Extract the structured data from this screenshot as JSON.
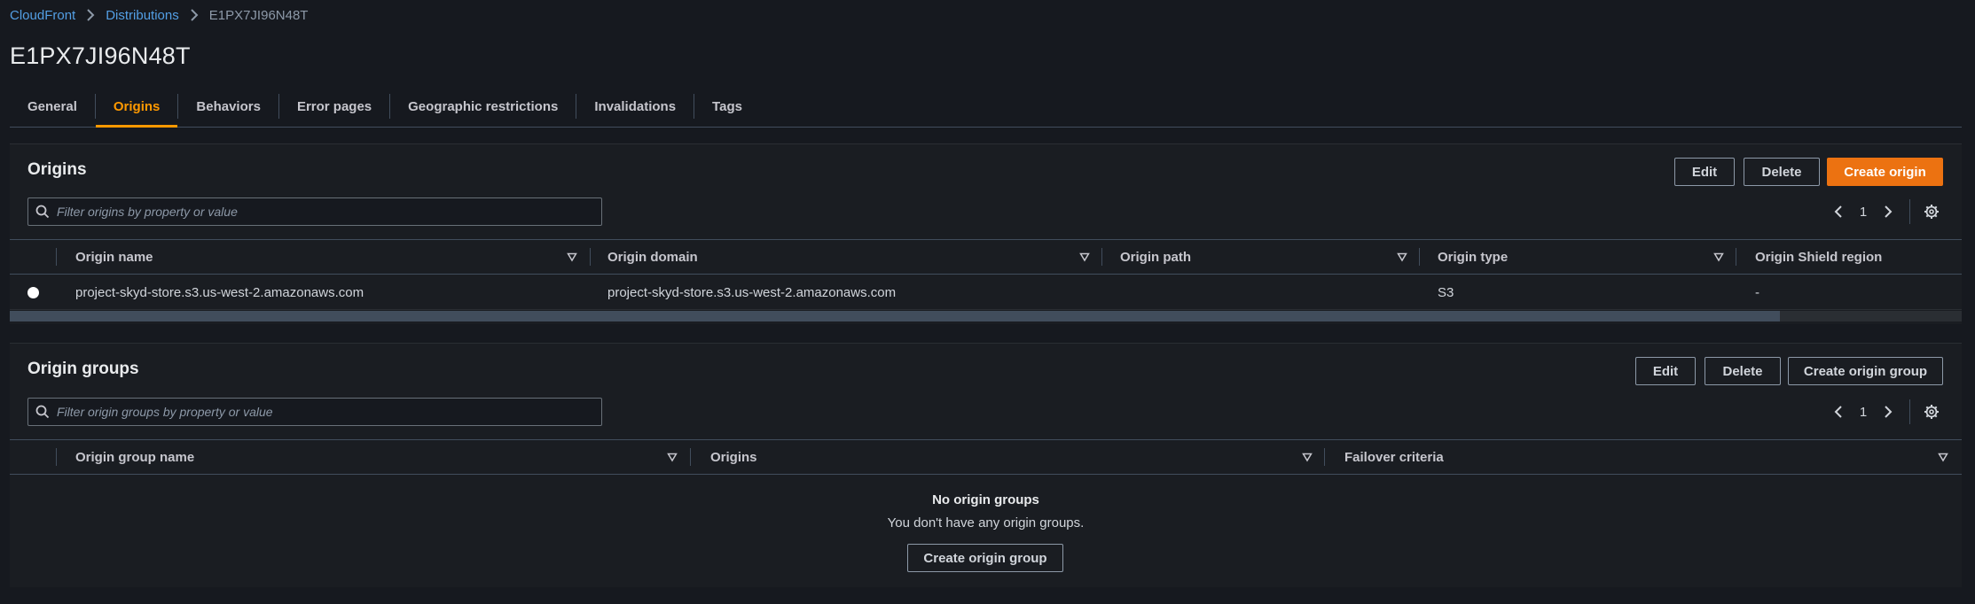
{
  "breadcrumb": {
    "items": [
      "CloudFront",
      "Distributions",
      "E1PX7JI96N48T"
    ]
  },
  "page": {
    "title": "E1PX7JI96N48T"
  },
  "tabs": [
    {
      "label": "General",
      "active": false
    },
    {
      "label": "Origins",
      "active": true
    },
    {
      "label": "Behaviors",
      "active": false
    },
    {
      "label": "Error pages",
      "active": false
    },
    {
      "label": "Geographic restrictions",
      "active": false
    },
    {
      "label": "Invalidations",
      "active": false
    },
    {
      "label": "Tags",
      "active": false
    }
  ],
  "origins": {
    "title": "Origins",
    "edit_label": "Edit",
    "delete_label": "Delete",
    "create_label": "Create origin",
    "filter_placeholder": "Filter origins by property or value",
    "page": "1",
    "columns": [
      "Origin name",
      "Origin domain",
      "Origin path",
      "Origin type",
      "Origin Shield region"
    ],
    "rows": [
      {
        "name": "project-skyd-store.s3.us-west-2.amazonaws.com",
        "domain": "project-skyd-store.s3.us-west-2.amazonaws.com",
        "path": "",
        "type": "S3",
        "shield_region": "-"
      }
    ]
  },
  "origin_groups": {
    "title": "Origin groups",
    "edit_label": "Edit",
    "delete_label": "Delete",
    "create_label": "Create origin group",
    "filter_placeholder": "Filter origin groups by property or value",
    "page": "1",
    "columns": [
      "Origin group name",
      "Origins",
      "Failover criteria"
    ],
    "empty_title": "No origin groups",
    "empty_text": "You don't have any origin groups.",
    "empty_button": "Create origin group"
  },
  "colors": {
    "background": "#16191f",
    "accent": "#ff9900",
    "primary_button": "#ec7211",
    "link": "#539fe5"
  }
}
